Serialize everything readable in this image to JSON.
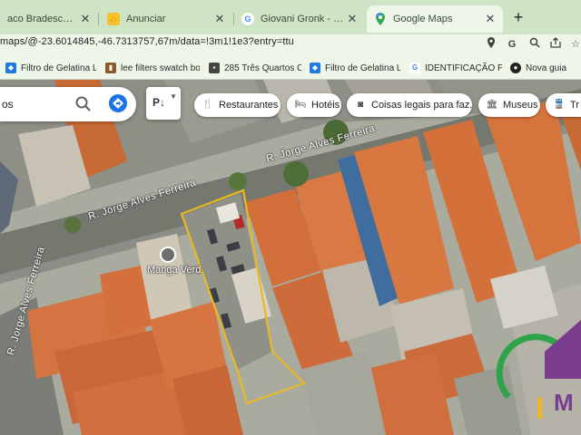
{
  "browser": {
    "tabs": [
      {
        "title": "aco Bradesco | Entre N",
        "icon": "bank-icon",
        "active": false
      },
      {
        "title": "Anunciar",
        "icon": "handshake-icon",
        "active": false
      },
      {
        "title": "Giovani Gronk - Pesquisa",
        "icon": "google-icon",
        "active": false
      },
      {
        "title": "Google Maps",
        "icon": "maps-pin-icon",
        "active": true
      }
    ],
    "url": "maps/@-23.6014845,-46.7313757,67m/data=!3m1!1e3?entry=ttu",
    "bookmarks": [
      {
        "label": "Filtro de Gelatina L...",
        "icon": "bookmark-site-icon"
      },
      {
        "label": "lee filters swatch bo...",
        "icon": "bookmark-site-icon"
      },
      {
        "label": "285 Três Quartos C...",
        "icon": "bookmark-site-icon"
      },
      {
        "label": "Filtro de Gelatina L...",
        "icon": "bookmark-site-icon"
      },
      {
        "label": "IDENTIFICAÇÃO PA...",
        "icon": "google-icon"
      },
      {
        "label": "Nova guia",
        "icon": "globe-icon"
      }
    ]
  },
  "maps": {
    "search_text": "os",
    "chips": [
      {
        "label": "Restaurantes",
        "icon": "fork-knife-icon"
      },
      {
        "label": "Hotéis",
        "icon": "bed-icon"
      },
      {
        "label": "Coisas legais para faz...",
        "icon": "camera-icon"
      },
      {
        "label": "Museus",
        "icon": "museum-icon"
      },
      {
        "label": "Tr",
        "icon": "transit-icon"
      }
    ],
    "road_labels": [
      "R. Jorge Alves Ferreira",
      "R. Jorge Alves Ferreira",
      "R. Jorge Alves Ferreira"
    ],
    "place_label": "Manga Verd"
  },
  "colors": {
    "tab_bar": "#cfe3c5",
    "toolbar": "#eef6e9",
    "lot_outline": "#e8b923",
    "roof_orange": "#d9733f",
    "road": "#7b7f79"
  }
}
